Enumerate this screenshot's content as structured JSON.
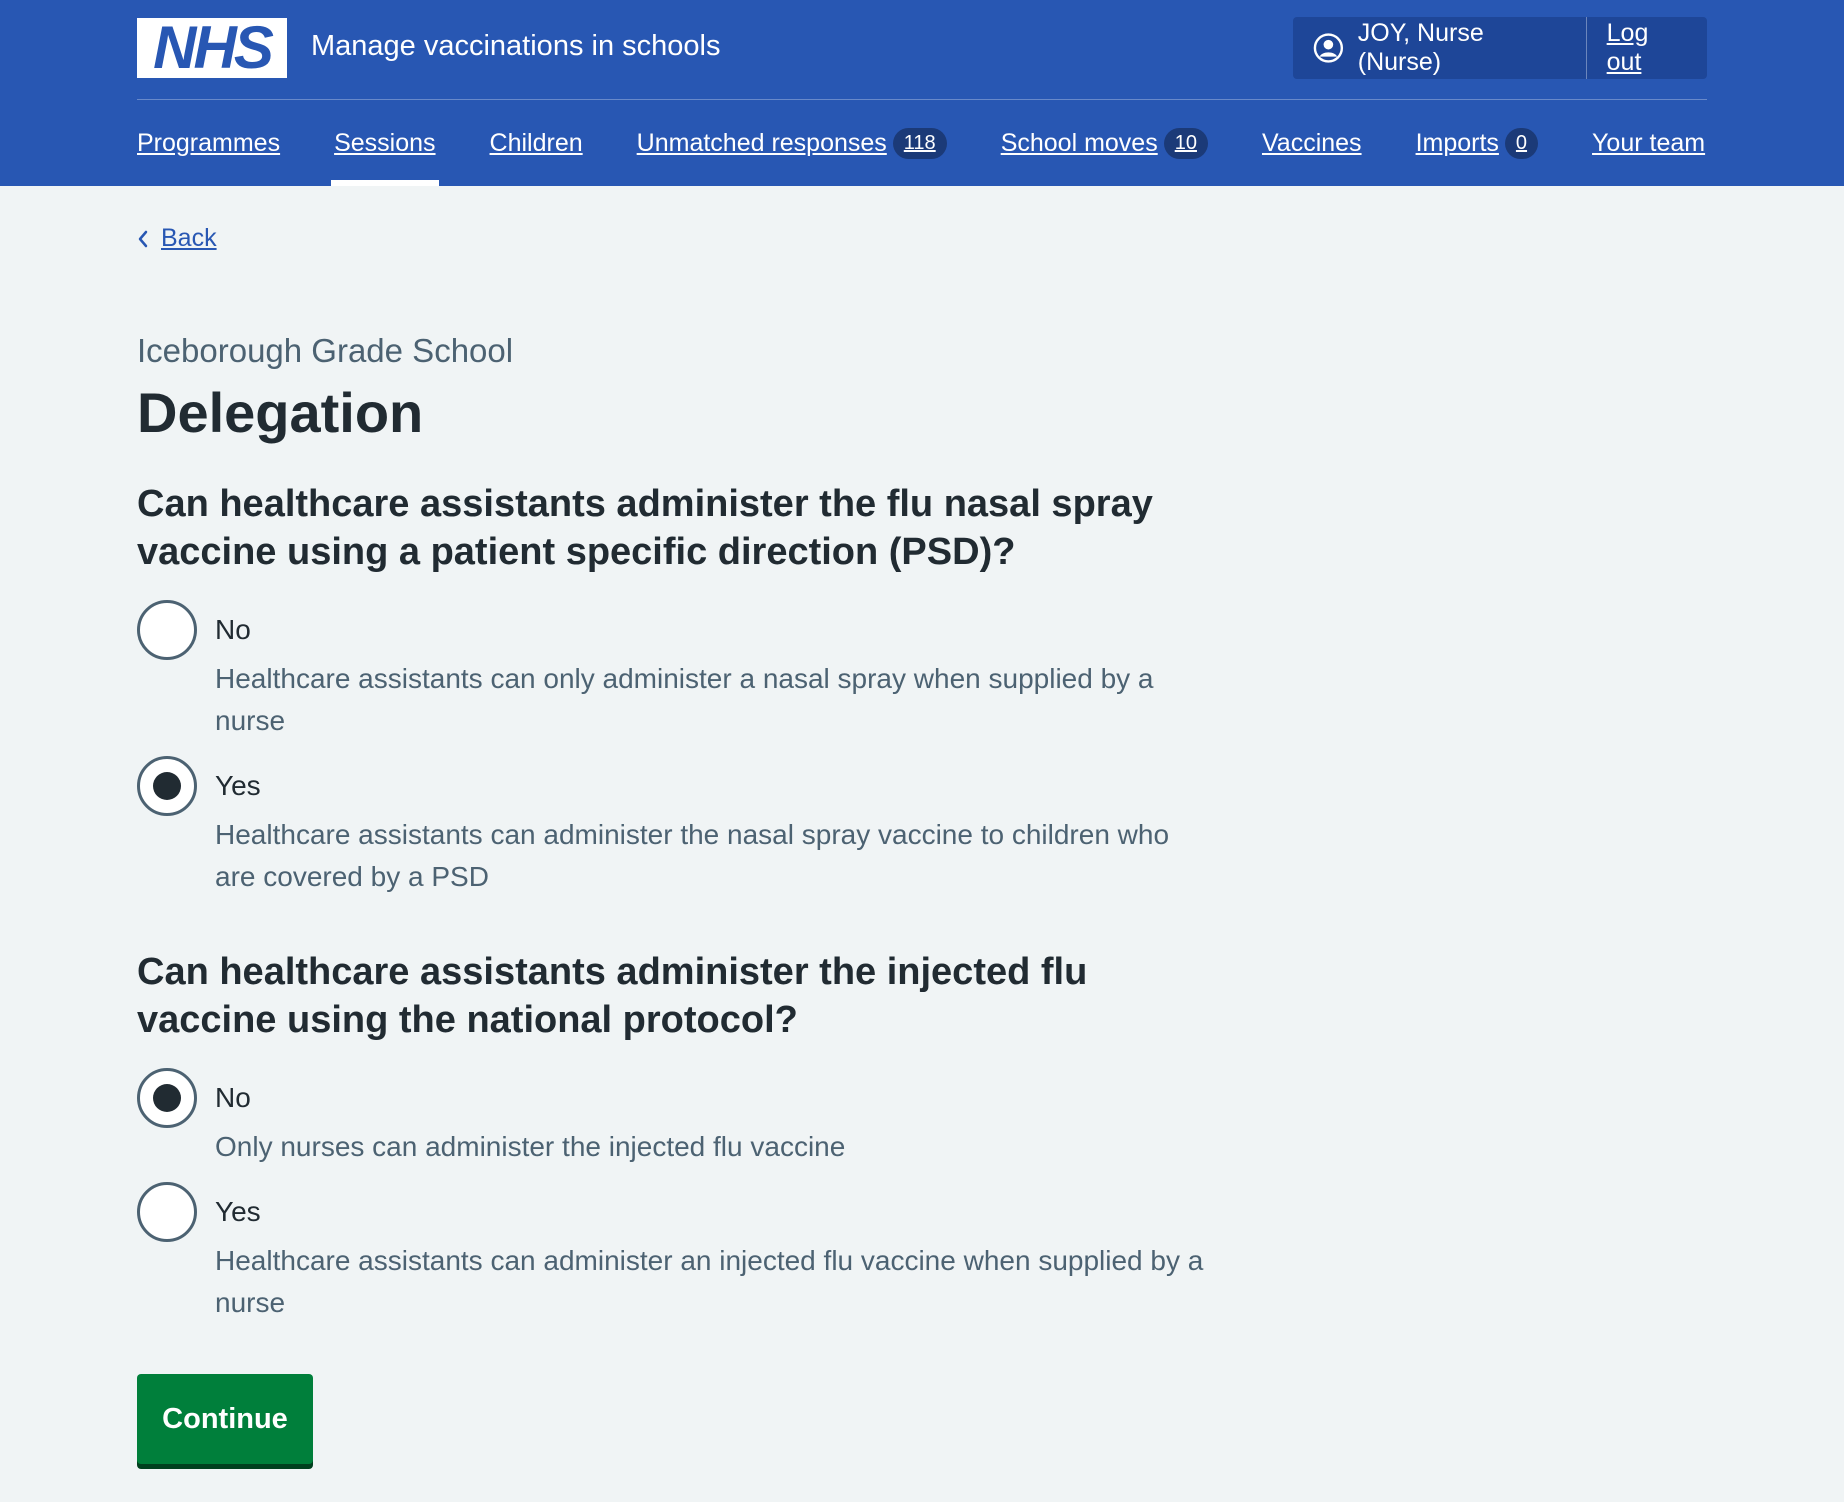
{
  "header": {
    "logo_text": "NHS",
    "service_name": "Manage vaccinations in schools",
    "user_label": "JOY, Nurse (Nurse)",
    "logout_label": "Log out"
  },
  "nav": {
    "programmes": "Programmes",
    "sessions": "Sessions",
    "children": "Children",
    "unmatched": "Unmatched responses",
    "unmatched_count": "118",
    "school_moves": "School moves",
    "school_moves_count": "10",
    "vaccines": "Vaccines",
    "imports": "Imports",
    "imports_count": "0",
    "your_team": "Your team",
    "active": "Sessions"
  },
  "back_label": "Back",
  "caption": "Iceborough Grade School",
  "title": "Delegation",
  "questions": [
    {
      "legend": "Can healthcare assistants administer the flu nasal spray vaccine using a patient specific direction (PSD)?",
      "options": [
        {
          "label": "No",
          "hint": "Healthcare assistants can only administer a nasal spray when supplied by a nurse",
          "checked": false
        },
        {
          "label": "Yes",
          "hint": "Healthcare assistants can administer the nasal spray vaccine to children who are covered by a PSD",
          "checked": true
        }
      ]
    },
    {
      "legend": "Can healthcare assistants administer the injected flu vaccine using the national protocol?",
      "options": [
        {
          "label": "No",
          "hint": "Only nurses can administer the injected flu vaccine",
          "checked": true
        },
        {
          "label": "Yes",
          "hint": "Healthcare assistants can administer an injected flu vaccine when supplied by a nurse",
          "checked": false
        }
      ]
    }
  ],
  "continue_label": "Continue",
  "colors": {
    "header_blue": "#2857b3",
    "page_background": "#f0f4f5",
    "button_green": "#007f3b",
    "text": "#212b32",
    "secondary_text": "#4c6272"
  }
}
